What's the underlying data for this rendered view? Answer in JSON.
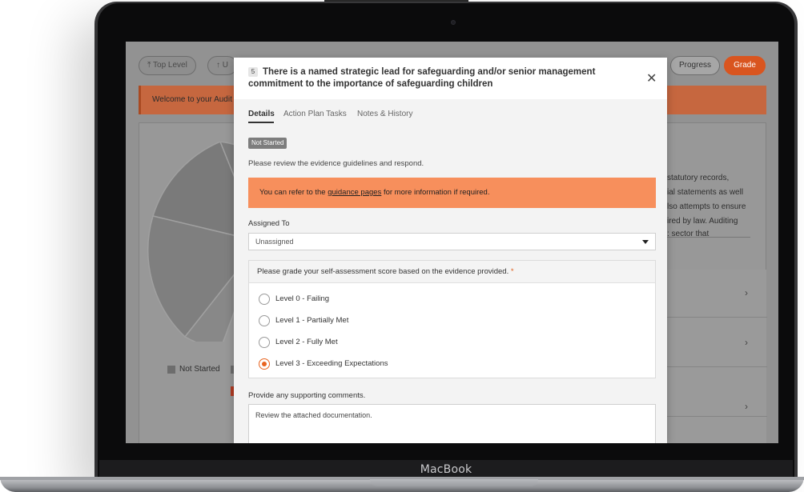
{
  "device": {
    "brand": "MacBook"
  },
  "toolbar": {
    "top_level_label": "Top Level",
    "up_label": "U",
    "progress_label": "Progress",
    "grade_label": "Grade"
  },
  "welcome": {
    "text": "Welcome to your Audit"
  },
  "legend": {
    "not_started": "Not Started"
  },
  "right_panel": {
    "lines": [
      "statutory records,",
      "ial statements as well",
      "lso attempts to ensure",
      "ired by law. Auditing",
      ": sector that"
    ]
  },
  "modal": {
    "number": "5",
    "title": "There is a named strategic lead for safeguarding and/or senior management commitment to the importance of safeguarding children",
    "tabs": [
      "Details",
      "Action Plan Tasks",
      "Notes & History"
    ],
    "status": "Not Started",
    "instructions": "Please review the evidence guidelines and respond.",
    "guidance_prefix": "You can refer to the ",
    "guidance_link": "guidance pages",
    "guidance_suffix": " for more information if required.",
    "assigned_label": "Assigned To",
    "assigned_value": "Unassigned",
    "grade_prompt": "Please grade your self-assessment score based on the evidence provided.",
    "required_mark": "*",
    "grade_options": [
      "Level 0 - Failing",
      "Level 1 - Partially Met",
      "Level 2 - Fully Met",
      "Level 3 - Exceeding Expectations"
    ],
    "selected_grade": "Level 3 - Exceeding Expectations",
    "comments_label": "Provide any supporting comments.",
    "comments_value": "Review the attached documentation."
  },
  "colors": {
    "accent": "#e8631f",
    "guidance_bg": "#f78f5c",
    "welcome_bg": "#c6673f"
  }
}
